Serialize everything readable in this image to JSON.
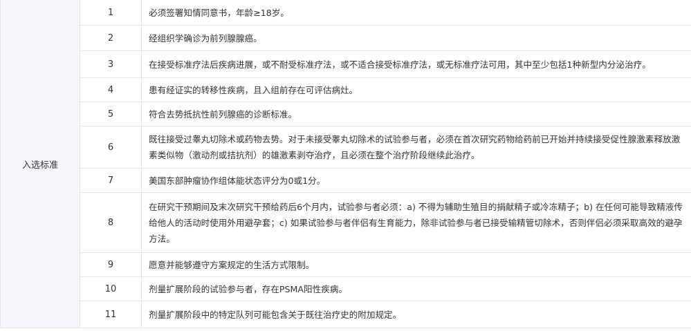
{
  "category_label": "入选标准",
  "criteria": [
    {
      "no": "1",
      "text": "必须签署知情同意书，年龄≥18岁。"
    },
    {
      "no": "2",
      "text": "经组织学确诊为前列腺腺癌。"
    },
    {
      "no": "3",
      "text": "在接受标准疗法后疾病进展，或不耐受标准疗法，或不适合接受标准疗法，或无标准疗法可用，其中至少包括1种新型内分泌治疗。"
    },
    {
      "no": "4",
      "text": "患有经证实的转移性疾病，且入组前存在可评估病灶。"
    },
    {
      "no": "5",
      "text": "符合去势抵抗性前列腺癌的诊断标准。"
    },
    {
      "no": "6",
      "text": "既往接受过睾丸切除术或药物去势。对于未接受睾丸切除术的试验参与者，必须在首次研究药物给药前已开始并持续接受促性腺激素释放激素类似物（激动剂或拮抗剂）的雄激素剥夺治疗，且必须在整个治疗阶段继续此治疗。"
    },
    {
      "no": "7",
      "text": "美国东部肿瘤协作组体能状态评分为0或1分。"
    },
    {
      "no": "8",
      "text": "在研究干预期间及末次研究干预给药后6个月内，试验参与者必须：a) 不得为辅助生殖目的捐献精子或冷冻精子；b) 在任何可能导致精液传给他人的活动时使用外用避孕套；c) 如果试验参与者伴侣有生育能力，除非试验参与者已接受输精管切除术，否则伴侣必须采取高效的避孕方法。"
    },
    {
      "no": "9",
      "text": "愿意并能够遵守方案规定的生活方式限制。"
    },
    {
      "no": "10",
      "text": "剂量扩展阶段的试验参与者，存在PSMA阳性疾病。"
    },
    {
      "no": "11",
      "text": "剂量扩展阶段中的特定队列可能包含关于既往治疗史的附加规定。"
    }
  ]
}
